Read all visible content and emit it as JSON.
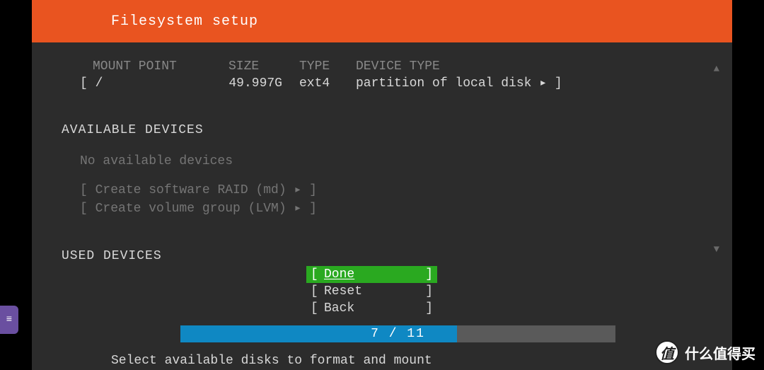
{
  "title": "Filesystem setup",
  "columns": {
    "mount": "MOUNT POINT",
    "size": "SIZE",
    "type": "TYPE",
    "devtype": "DEVICE TYPE"
  },
  "entries": [
    {
      "mount": "/",
      "size": "49.997G",
      "type": "ext4",
      "devtype": "partition of local disk"
    }
  ],
  "sections": {
    "available": "AVAILABLE DEVICES",
    "used": "USED DEVICES"
  },
  "no_available": "No available devices",
  "actions": {
    "raid": "Create software RAID (md)",
    "lvm": "Create volume group (LVM)"
  },
  "buttons": {
    "done": "Done",
    "reset": "Reset",
    "back": "Back"
  },
  "progress": {
    "current": 7,
    "total": 11,
    "text": "7 / 11",
    "percent": 63.6
  },
  "help": "Select available disks to format and mount",
  "watermark": "什么值得买",
  "watermark_badge": "值"
}
